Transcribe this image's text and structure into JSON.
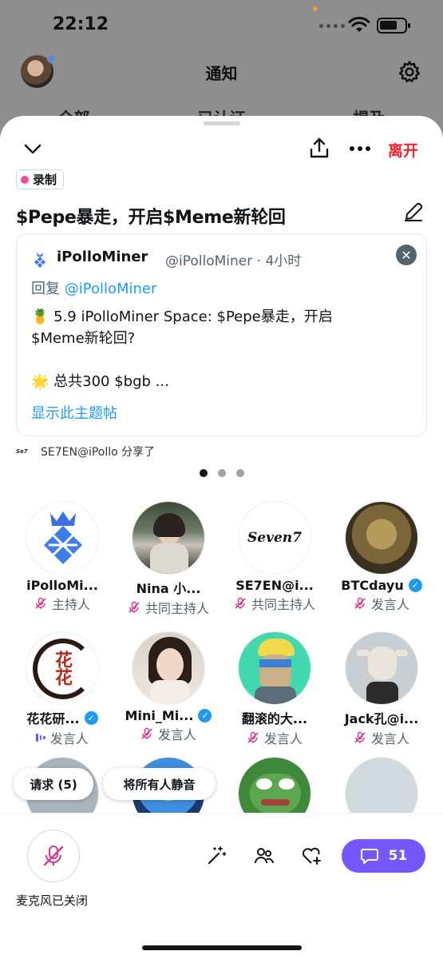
{
  "status_bar": {
    "time": "22:12"
  },
  "background_screen": {
    "title": "通知",
    "tabs": [
      "全部",
      "已认证",
      "提及"
    ]
  },
  "sheet": {
    "leave_label": "离开",
    "recording_badge": "录制",
    "space_title": "$Pepe暴走，开启$Meme新轮回",
    "tweet": {
      "author_name": "iPolloMiner",
      "author_handle": "@iPolloMiner · 4小时",
      "reply_prefix": "回复",
      "reply_mention": "@iPolloMiner",
      "body_line1": "🍍 5.9 iPolloMiner Space: $Pepe暴走，开启",
      "body_line2": "$Meme新轮回?",
      "body_line3": "🌟 总共300 $bgb ...",
      "show_thread": "显示此主题帖"
    },
    "shared_by": {
      "logo_text": "Se7",
      "text": "SE7EN@iPollo 分享了"
    },
    "participants": [
      {
        "name": "iPolloMi...",
        "role": "主持人",
        "verified": false,
        "mic": "off"
      },
      {
        "name": "Nina 小...",
        "role": "共同主持人",
        "verified": false,
        "mic": "off"
      },
      {
        "name": "SE7EN@i...",
        "role": "共同主持人",
        "verified": false,
        "mic": "off",
        "avatar_text": "Seven7"
      },
      {
        "name": "BTCdayu",
        "role": "发言人",
        "verified": true,
        "mic": "off"
      },
      {
        "name": "花花研...",
        "role": "发言人",
        "verified": true,
        "mic": "speaking",
        "avatar_text": "花花"
      },
      {
        "name": "Mini_Mi...",
        "role": "发言人",
        "verified": true,
        "mic": "off"
      },
      {
        "name": "翻滚的大...",
        "role": "发言人",
        "verified": false,
        "mic": "off"
      },
      {
        "name": "Jack孔@i...",
        "role": "发言人",
        "verified": false,
        "mic": "off"
      }
    ],
    "requests_button": "请求 (5)",
    "mute_all_button": "将所有人静音",
    "mic_label": "麦克风已关闭",
    "chat_count": "51"
  },
  "colors": {
    "accent_purple": "#7856ff",
    "leave_red": "#f4212e",
    "link_blue": "#1d9bf0",
    "mic_off_pink": "#d6388b"
  }
}
